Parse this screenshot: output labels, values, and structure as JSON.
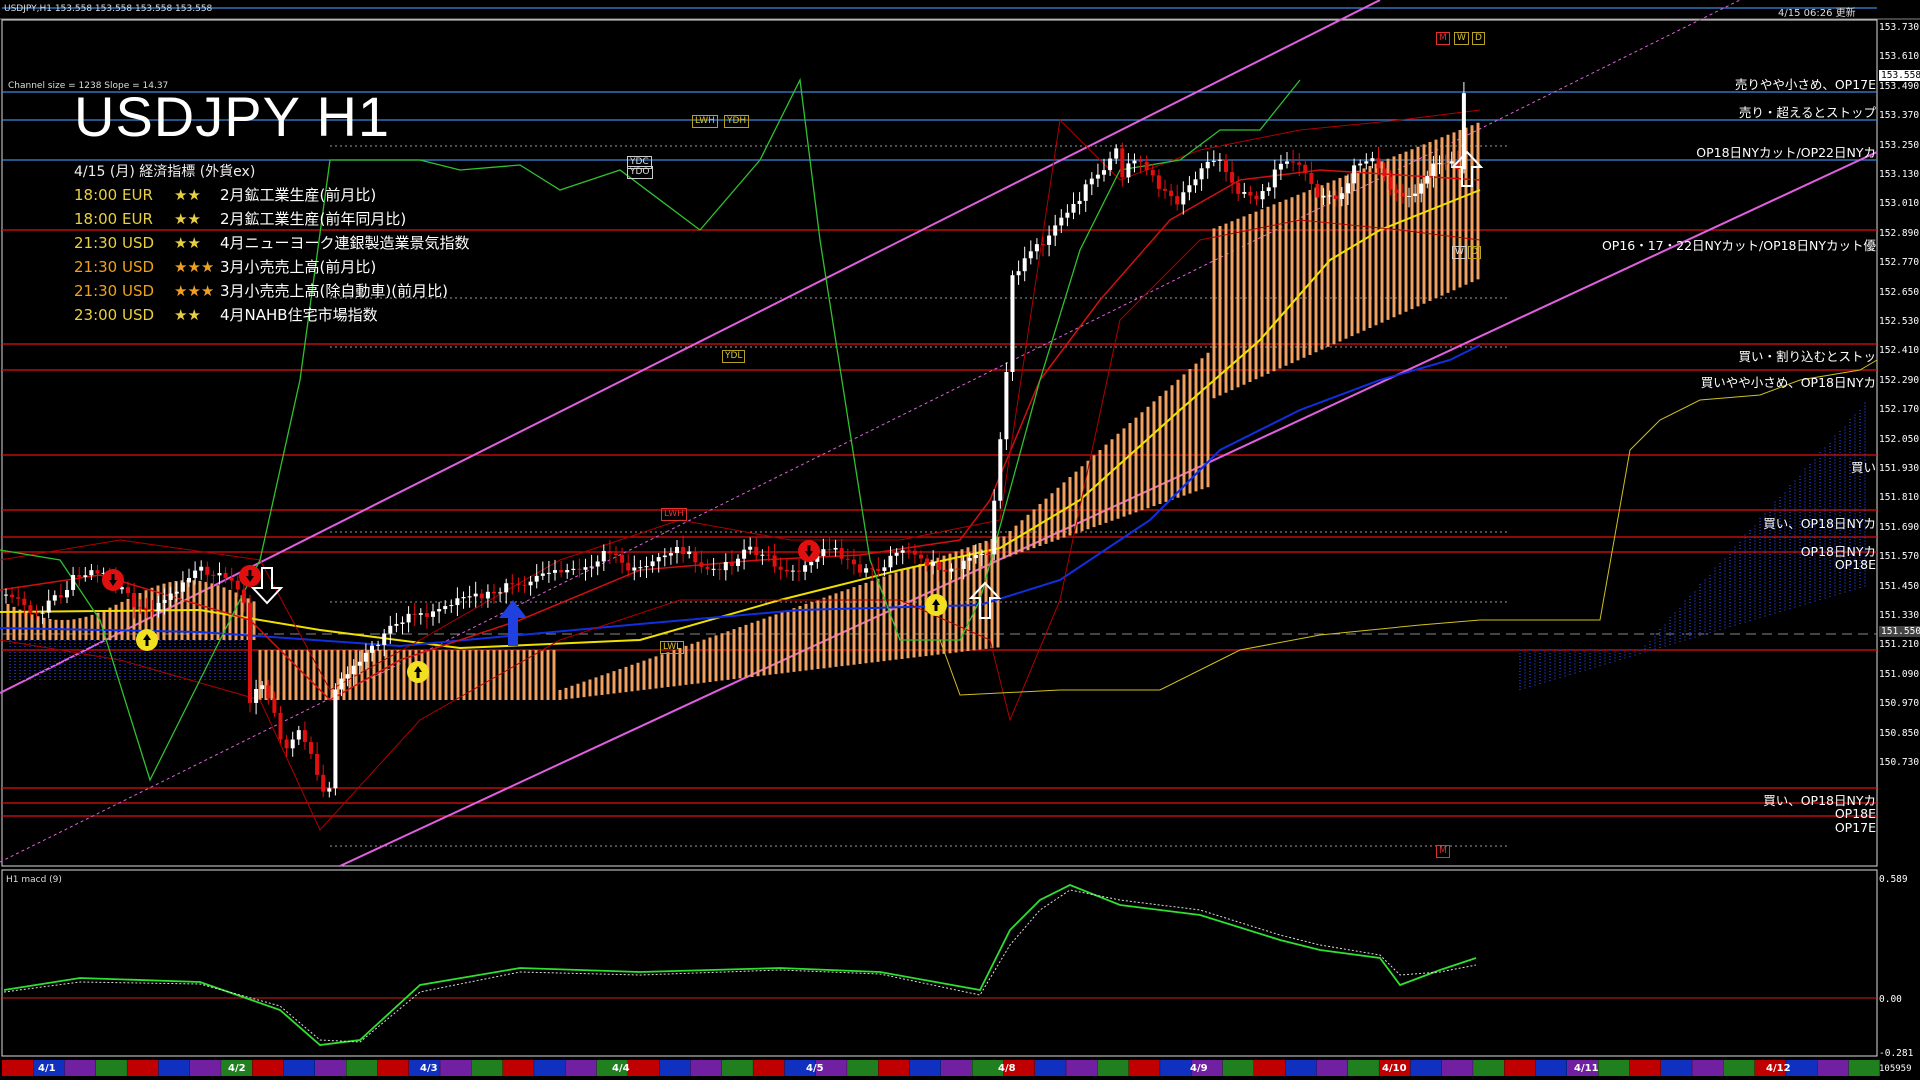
{
  "window": {
    "header_left": "USDJPY,H1  153.558 153.558 153.558 153.558",
    "header_right": "4/15 06:26 更新"
  },
  "chart": {
    "title": "USDJPY H1",
    "channel_info": "Channel size = 1238 Slope = 14.37",
    "events_header": "4/15 (月) 経済指標 (外貨ex)",
    "events": [
      {
        "time": "18:00 EUR",
        "stars": "★★",
        "name": "2月鉱工業生産(前月比)",
        "color": "#e8d040"
      },
      {
        "time": "18:00 EUR",
        "stars": "★★",
        "name": "2月鉱工業生産(前年同月比)",
        "color": "#e8d040"
      },
      {
        "time": "21:30 USD",
        "stars": "★★",
        "name": "4月ニューヨーク連銀製造業景気指数",
        "color": "#e8d040"
      },
      {
        "time": "21:30 USD",
        "stars": "★★★",
        "name": "3月小売売上高(前月比)",
        "color": "#f0a020"
      },
      {
        "time": "21:30 USD",
        "stars": "★★★",
        "name": "3月小売売上高(除自動車)(前月比)",
        "color": "#f0a020"
      },
      {
        "time": "23:00 USD",
        "stars": "★★",
        "name": "4月NAHB住宅市場指数",
        "color": "#e8d040"
      }
    ],
    "levels": [
      {
        "label": "売りやや小さめ、OP17E"
      },
      {
        "label": "売り・超えるとストップ"
      },
      {
        "label": "OP18日NYカット/OP22日NYカ"
      },
      {
        "label": "OP16・17・22日NYカット/OP18日NYカット優"
      },
      {
        "label": "買い・割り込むとストッ"
      },
      {
        "label": "買いやや小さめ、OP18日NYカ"
      },
      {
        "label": "買い"
      },
      {
        "label": "買い、OP18日NYカ"
      },
      {
        "label": "OP18日NYカ"
      },
      {
        "label": "OP18E"
      },
      {
        "label": "買い、OP18日NYカ"
      },
      {
        "label": "OP18E"
      },
      {
        "label": "OP17E"
      }
    ],
    "price_axis": [
      "153.730",
      "153.610",
      "153.490",
      "153.370",
      "153.250",
      "153.130",
      "153.010",
      "152.890",
      "152.770",
      "152.650",
      "152.530",
      "152.410",
      "152.290",
      "152.170",
      "152.050",
      "151.930",
      "151.810",
      "151.690",
      "151.570",
      "151.450",
      "151.330",
      "151.210",
      "151.090",
      "150.970",
      "150.850",
      "150.730"
    ],
    "current_price": "153.558",
    "marked_price": "151.550",
    "tags": {
      "m": "M",
      "w": "W",
      "d": "D",
      "lwh": "LWH",
      "ydh": "YDH",
      "ydc": "YDC",
      "ydo": "YDO",
      "ydl": "YDL",
      "lwl": "LWL",
      "lwh2": "LWH"
    }
  },
  "macd": {
    "label": "H1  macd (9)",
    "top_value": "0.589",
    "zero_value": "0.00",
    "bottom_value": "-0.281",
    "volume": "105959"
  },
  "dates": [
    "4/1",
    "4/2",
    "4/3",
    "4/4",
    "4/5",
    "4/8",
    "4/9",
    "4/10",
    "4/11",
    "4/12"
  ],
  "colors": {
    "red_level": "#e01010",
    "blue_level": "#3a8ae0",
    "channel": "#e060e0",
    "ma_yellow": "#f0e000",
    "ma_blue": "#1030e0",
    "cloud": "#f0a060",
    "macd_green": "#30e030"
  }
}
